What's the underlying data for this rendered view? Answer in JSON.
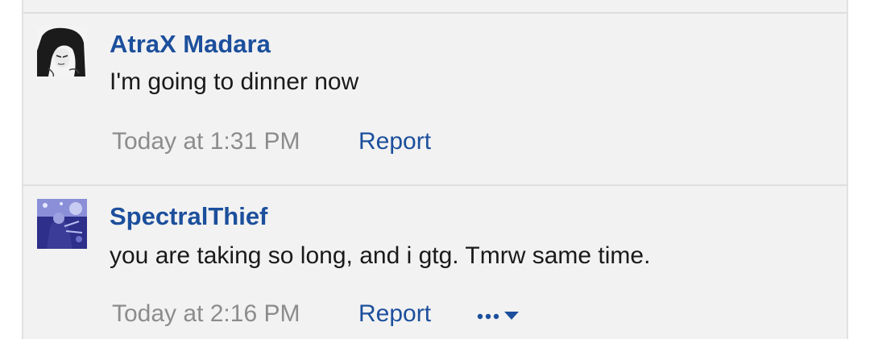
{
  "posts": [
    {
      "username": "AtraX Madara",
      "message": "I'm going to dinner now",
      "time": "Today at 1:31 PM",
      "report_label": "Report"
    },
    {
      "username": "SpectralThief",
      "message": "you are taking so long, and i gtg. Tmrw same time.",
      "time": "Today at 2:16 PM",
      "report_label": "Report",
      "more_icon": "more-options-dropdown-icon"
    }
  ],
  "colors": {
    "username": "#1c4f9c",
    "link": "#1c4f9c",
    "timestamp": "#8c8c8c",
    "message": "#1a1a1a",
    "background": "#f2f2f2"
  }
}
